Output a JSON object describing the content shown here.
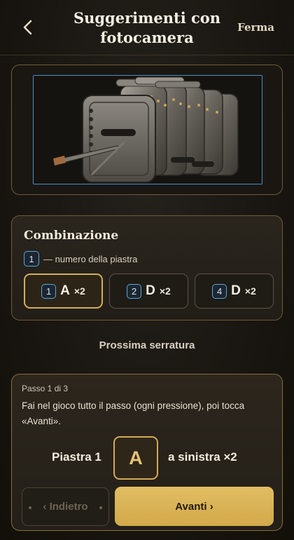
{
  "header": {
    "title": "Suggerimenti con fotocamera",
    "back_icon": "chevron-left-icon",
    "stop_label": "Ferma"
  },
  "combination": {
    "title": "Combinazione",
    "legend_number": "1",
    "legend_text": "— numero della piastra",
    "items": [
      {
        "plate": "1",
        "letter": "A",
        "count": "×2",
        "active": true
      },
      {
        "plate": "2",
        "letter": "D",
        "count": "×2",
        "active": false
      },
      {
        "plate": "4",
        "letter": "D",
        "count": "×2",
        "active": false
      }
    ]
  },
  "next_lock_label": "Prossima serratura",
  "step": {
    "counter": "Passo 1 di 3",
    "instruction": "Fai nel gioco tutto il passo (ogni pressione), poi tocca «Avanti».",
    "plate_label": "Piastra 1",
    "letter": "A",
    "direction_label": "a sinistra ×2",
    "prev_label": "‹ Indietro",
    "next_label": "Avanti ›"
  },
  "colors": {
    "accent_gold": "#d5ad5a",
    "frame_blue": "#4e8fc2",
    "background": "#17140f"
  }
}
